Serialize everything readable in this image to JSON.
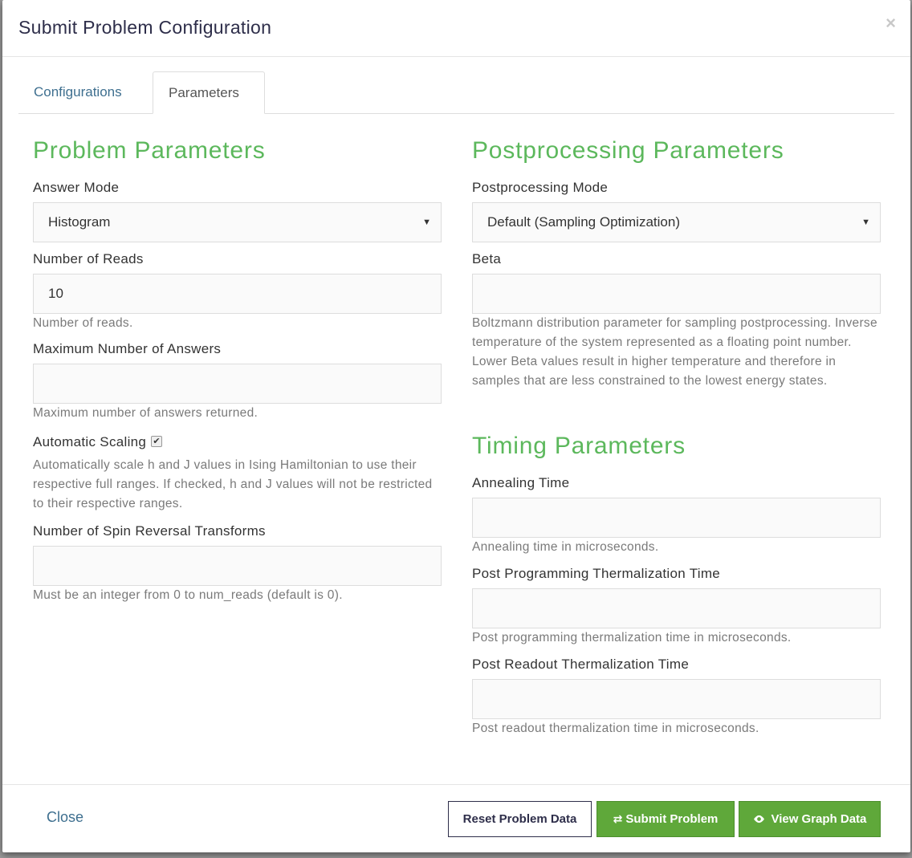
{
  "modal": {
    "title": "Submit Problem Configuration",
    "close_symbol": "×"
  },
  "tabs": [
    {
      "label": "Configurations",
      "active": false
    },
    {
      "label": "Parameters",
      "active": true
    }
  ],
  "problem": {
    "title": "Problem Parameters",
    "answer_mode": {
      "label": "Answer Mode",
      "value": "Histogram"
    },
    "num_reads": {
      "label": "Number of Reads",
      "value": "10",
      "help": "Number of reads."
    },
    "max_answers": {
      "label": "Maximum Number of Answers",
      "value": "",
      "help": "Maximum number of answers returned."
    },
    "auto_scale": {
      "label": "Automatic Scaling",
      "checked": true,
      "check_mark": "✔",
      "help": "Automatically scale h and J values in Ising Hamiltonian to use their respective full ranges. If checked, h and J values will not be restricted to their respective ranges."
    },
    "spin_reversal": {
      "label": "Number of Spin Reversal Transforms",
      "value": "",
      "help": "Must be an integer from 0 to num_reads (default is 0)."
    }
  },
  "postprocessing": {
    "title": "Postprocessing Parameters",
    "mode": {
      "label": "Postprocessing Mode",
      "value": "Default (Sampling Optimization)"
    },
    "beta": {
      "label": "Beta",
      "value": "",
      "help": "Boltzmann distribution parameter for sampling postprocessing. Inverse temperature of the system represented as a floating point number. Lower Beta values result in higher temperature and therefore in samples that are less constrained to the lowest energy states."
    }
  },
  "timing": {
    "title": "Timing Parameters",
    "annealing": {
      "label": "Annealing Time",
      "value": "",
      "help": "Annealing time in microseconds."
    },
    "post_programming": {
      "label": "Post Programming Thermalization Time",
      "value": "",
      "help": "Post programming thermalization time in microseconds."
    },
    "post_readout": {
      "label": "Post Readout Thermalization Time",
      "value": "",
      "help": "Post readout thermalization time in microseconds."
    }
  },
  "footer": {
    "close_label": "Close",
    "reset_label": "Reset Problem Data",
    "submit_label": "Submit Problem",
    "submit_icon": "exchange-icon",
    "view_label": "View Graph Data",
    "view_icon": "eye-icon"
  },
  "colors": {
    "accent_green": "#5cb85c",
    "button_green": "#5fa83a",
    "link_blue": "#3e6f8f",
    "title_navy": "#2e2e4a"
  },
  "caret_symbol": "▼"
}
